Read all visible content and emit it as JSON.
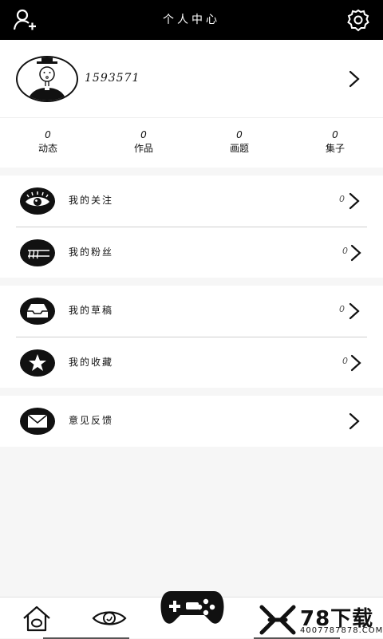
{
  "header": {
    "title": "个人中心",
    "add_user_icon": "add-user-icon",
    "settings_icon": "gear-icon"
  },
  "profile": {
    "username": "1593571"
  },
  "stats": [
    {
      "count": "0",
      "label": "动态"
    },
    {
      "count": "0",
      "label": "作品"
    },
    {
      "count": "0",
      "label": "画题"
    },
    {
      "count": "0",
      "label": "集子"
    }
  ],
  "menu": {
    "follow": {
      "label": "我的关注",
      "count": "0",
      "icon": "eye-icon"
    },
    "fans": {
      "label": "我的粉丝",
      "count": "0",
      "icon": "fans-icon"
    },
    "drafts": {
      "label": "我的草稿",
      "count": "0",
      "icon": "inbox-icon"
    },
    "favorites": {
      "label": "我的收藏",
      "count": "0",
      "icon": "star-icon"
    },
    "feedback": {
      "label": "意见反馈",
      "icon": "mail-icon"
    }
  },
  "bottom_nav": {
    "icons": [
      "home-icon",
      "eye-icon",
      "gamepad-icon"
    ]
  },
  "watermark": {
    "big": "78下载",
    "small": "4007787878.COM"
  }
}
